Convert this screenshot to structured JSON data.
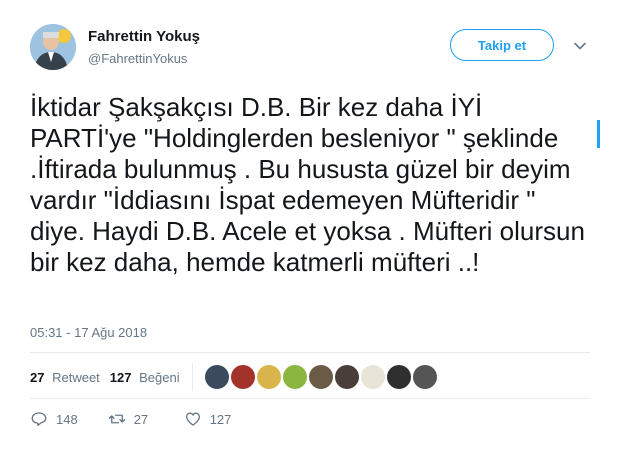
{
  "author": {
    "name": "Fahrettin Yokuş",
    "handle": "@FahrettinYokus",
    "avatar_icon": "profile-photo"
  },
  "follow_button": {
    "label": "Takip et"
  },
  "tweet": {
    "text": "İktidar Şakşakçısı D.B. Bir kez daha İYİ PARTİ'ye \"Holdinglerden besleniyor \" şeklinde .İftirada bulunmuş . Bu hususta güzel bir deyim vardır \"İddiasını İspat edemeyen Müfteridir \" diye. Haydi D.B. Acele et yoksa . Müfteri olursun bir kez daha, hemde katmerli müfteri ..!",
    "timestamp": "05:31 - 17 Ağu 2018"
  },
  "stats": {
    "retweets": {
      "count": "27",
      "label": "Retweet"
    },
    "likes": {
      "count": "127",
      "label": "Beğeni"
    },
    "liker_avatars": [
      {
        "name": "liker-avatar",
        "color": "#3b4a5c"
      },
      {
        "name": "liker-avatar",
        "color": "#a3322a"
      },
      {
        "name": "liker-avatar",
        "color": "#d9b44a"
      },
      {
        "name": "liker-avatar",
        "color": "#8bb640"
      },
      {
        "name": "liker-avatar",
        "color": "#6b5a45"
      },
      {
        "name": "liker-avatar",
        "color": "#4a3e3a"
      },
      {
        "name": "liker-avatar",
        "color": "#e8e4d8"
      },
      {
        "name": "liker-avatar",
        "color": "#2f2f2f"
      },
      {
        "name": "liker-avatar",
        "color": "#555555"
      }
    ]
  },
  "actions": {
    "reply": {
      "count": "148",
      "icon": "reply-icon"
    },
    "retweet": {
      "count": "27",
      "icon": "retweet-icon"
    },
    "like": {
      "count": "127",
      "icon": "heart-icon"
    }
  },
  "colors": {
    "accent": "#1da1f2",
    "secondary_text": "#657786",
    "divider": "#e6ecf0"
  }
}
